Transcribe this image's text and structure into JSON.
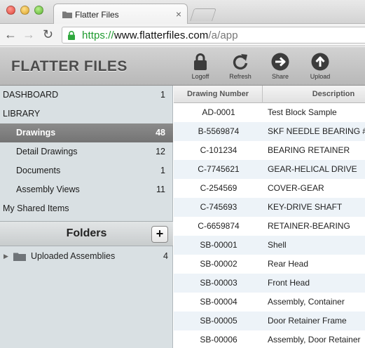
{
  "browser": {
    "tab_title": "Flatter Files",
    "tab_close": "×",
    "url_scheme": "https://",
    "url_host": "www.flatterfiles.com",
    "url_path": "/a/app"
  },
  "header": {
    "brand": "FLATTER FILES",
    "buttons": [
      {
        "label": "Logoff",
        "icon": "lock-icon"
      },
      {
        "label": "Refresh",
        "icon": "refresh-icon"
      },
      {
        "label": "Share",
        "icon": "arrow-right-icon"
      },
      {
        "label": "Upload",
        "icon": "arrow-up-icon"
      }
    ]
  },
  "sidebar": {
    "items": [
      {
        "label": "DASHBOARD",
        "count": "1"
      },
      {
        "label": "LIBRARY",
        "count": ""
      },
      {
        "label": "Drawings",
        "count": "48"
      },
      {
        "label": "Detail Drawings",
        "count": "12"
      },
      {
        "label": "Documents",
        "count": "1"
      },
      {
        "label": "Assembly Views",
        "count": "11"
      },
      {
        "label": "My Shared Items",
        "count": ""
      }
    ],
    "folders_title": "Folders",
    "add_label": "+",
    "folders": [
      {
        "label": "Uploaded Assemblies",
        "count": "4"
      }
    ]
  },
  "table": {
    "columns": [
      "Drawing Number",
      "Description"
    ],
    "rows": [
      [
        "AD-0001",
        "Test Block Sample"
      ],
      [
        "B-5569874",
        "SKF NEEDLE BEARING #"
      ],
      [
        "C-101234",
        "BEARING RETAINER"
      ],
      [
        "C-7745621",
        "GEAR-HELICAL DRIVE"
      ],
      [
        "C-254569",
        "COVER-GEAR"
      ],
      [
        "C-745693",
        "KEY-DRIVE SHAFT"
      ],
      [
        "C-6659874",
        "RETAINER-BEARING"
      ],
      [
        "SB-00001",
        "Shell"
      ],
      [
        "SB-00002",
        "Rear Head"
      ],
      [
        "SB-00003",
        "Front Head"
      ],
      [
        "SB-00004",
        "Assembly, Container"
      ],
      [
        "SB-00005",
        "Door Retainer Frame"
      ],
      [
        "SB-00006",
        "Assembly, Door Retainer"
      ]
    ]
  },
  "colors": {
    "active_nav": "#7f7f7f",
    "url_secure": "#1e9a2e",
    "sidebar_bg": "#d9e0e3",
    "row_alt": "#edf3f8"
  }
}
